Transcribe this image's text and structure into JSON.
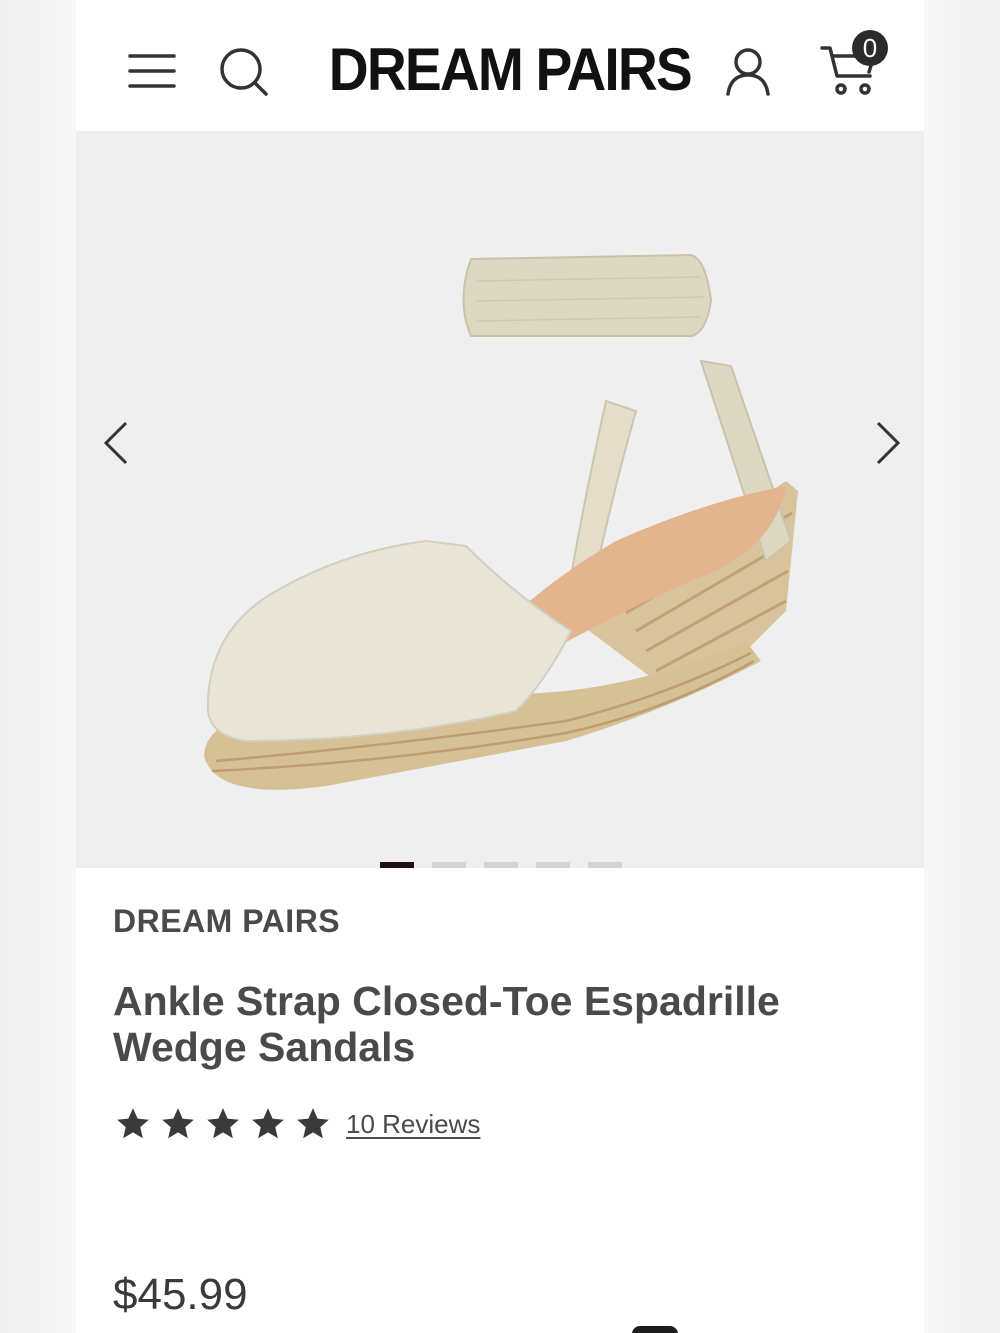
{
  "header": {
    "logo_text": "DREAM PAIRS",
    "cart_count": "0",
    "icons": [
      "hamburger-menu-icon",
      "search-icon",
      "account-icon",
      "cart-icon"
    ]
  },
  "gallery": {
    "total_images": 5,
    "active_index": 0,
    "image_alt": "Ankle Strap Closed-Toe Espadrille Wedge Sandals"
  },
  "product": {
    "brand": "DREAM PAIRS",
    "title": "Ankle Strap Closed-Toe Espadrille Wedge Sandals",
    "rating": 5,
    "reviews_label": "10 Reviews",
    "price": "$45.99"
  },
  "colors": {
    "text": "#4a4a4a",
    "logo": "#111111",
    "active_dot": "#1e1114",
    "inactive_dot": "#d4d4d4",
    "gallery_bg": "#efefef"
  }
}
